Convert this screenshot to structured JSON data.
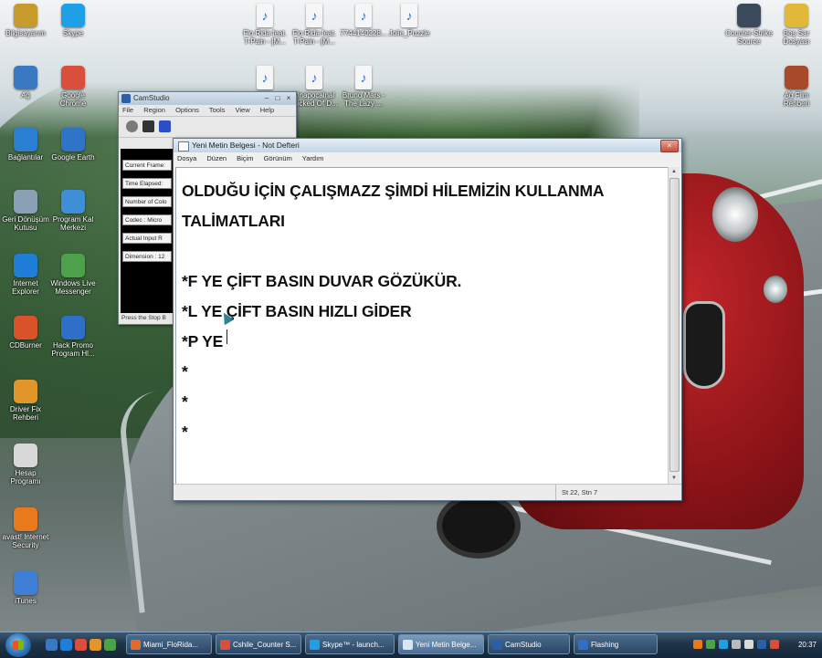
{
  "desktop": {
    "icons_left": [
      {
        "label": "Bilgisayarım",
        "icon": "computer-icon",
        "color": "#c79a2c"
      },
      {
        "label": "Ağ",
        "icon": "network-icon",
        "color": "#3a78c2"
      },
      {
        "label": "Bağlantılar",
        "icon": "connections-icon",
        "color": "#2a7fd0"
      },
      {
        "label": "Geri Dönüşüm Kutusu",
        "icon": "recycle-bin-icon",
        "color": "#8aa0b4"
      },
      {
        "label": "Internet Explorer",
        "icon": "ie-icon",
        "color": "#1f7fd6"
      },
      {
        "label": "CDBurner",
        "icon": "cdburner-icon",
        "color": "#d9532a"
      },
      {
        "label": "Driver Fix Rehberi",
        "icon": "driver-icon",
        "color": "#e0962a"
      },
      {
        "label": "Hesap Programı",
        "icon": "calculator-icon",
        "color": "#d8d8d8"
      },
      {
        "label": "avast! Internet Security",
        "icon": "avast-icon",
        "color": "#e87a1c"
      },
      {
        "label": "iTunes",
        "icon": "itunes-icon",
        "color": "#3f7fd6"
      }
    ],
    "icons_col2": [
      {
        "label": "Skype",
        "icon": "skype-icon",
        "color": "#1ea0e6"
      },
      {
        "label": "Google Chrome",
        "icon": "chrome-icon",
        "color": "#d94f3c"
      },
      {
        "label": "Google Earth",
        "icon": "google-earth-icon",
        "color": "#2f74c8"
      },
      {
        "label": "Program Kal Merkezi",
        "icon": "program-icon",
        "color": "#3f8fd8"
      },
      {
        "label": "Windows Live Messenger",
        "icon": "messenger-icon",
        "color": "#4ca14a"
      },
      {
        "label": "Hack Promo Program Hl...",
        "icon": "hack-icon",
        "color": "#2f6fc8"
      }
    ],
    "icons_top": [
      {
        "label": "Flo Rida feat. T-Pain - [M...",
        "icon": "audio-file-icon"
      },
      {
        "label": "Flo Rida feat. T-Pain - [M...",
        "icon": "audio-file-icon"
      },
      {
        "label": "7744140228...",
        "icon": "audio-file-icon"
      },
      {
        "label": "Jolie_Puzzle",
        "icon": "audio-file-icon"
      },
      {
        "label": "",
        "icon": "audio-file-icon"
      },
      {
        "label": "Unapocalnal Clicked Of D...",
        "icon": "audio-file-icon"
      },
      {
        "label": "Bruno Mars - The Lazy ...",
        "icon": "audio-file-icon"
      }
    ],
    "icons_right": [
      {
        "label": "Counter-Strike Source",
        "icon": "counter-strike-icon",
        "color": "#3a4a5c"
      },
      {
        "label": "Boş Sar Dosyası",
        "icon": "folder-icon",
        "color": "#e2b83a"
      },
      {
        "label": "Ağ Film Rehberi",
        "icon": "film-icon",
        "color": "#a84a2a"
      }
    ]
  },
  "camstudio": {
    "title": "CamStudio",
    "menu": [
      "File",
      "Region",
      "Options",
      "Tools",
      "View",
      "Help"
    ],
    "fields": [
      "Current Frame:",
      "Time Elapsed:",
      "Number of Colo",
      "Codec : Micro",
      "Actual Input R",
      "Dimension : 12"
    ],
    "status": "Press the Stop B"
  },
  "notepad": {
    "title": "Yeni Metin Belgesi - Not Defteri",
    "menu": [
      "Dosya",
      "Düzen",
      "Biçim",
      "Görünüm",
      "Yardım"
    ],
    "lines": [
      "OLDUĞU İÇİN ÇALIŞMAZZ ŞİMDİ HİLEMİZİN KULLANMA",
      "TALİMATLARI",
      "",
      "*F YE ÇİFT BASIN DUVAR GÖZÜKÜR.",
      "*L YE ÇİFT BASIN HIZLI GİDER",
      "*P YE",
      "*",
      "*",
      "*"
    ],
    "status": "St 22, Stn 7"
  },
  "taskbar": {
    "tasks": [
      {
        "label": "Miami_FloRida...",
        "icon": "media-player-icon",
        "color": "#e26a2c"
      },
      {
        "label": "Cshile_Counter S...",
        "icon": "chrome-icon",
        "color": "#d94f3c"
      },
      {
        "label": "Skype™ - launch...",
        "icon": "skype-icon",
        "color": "#1ea0e6"
      },
      {
        "label": "Yeni Metin Belge...",
        "icon": "notepad-icon",
        "color": "#d9e6f2"
      },
      {
        "label": "CamStudio",
        "icon": "camstudio-icon",
        "color": "#2b5ea8"
      },
      {
        "label": "Flashing",
        "icon": "flash-icon",
        "color": "#2f6fc8"
      }
    ],
    "active_task": 3,
    "clock": "20:37"
  }
}
